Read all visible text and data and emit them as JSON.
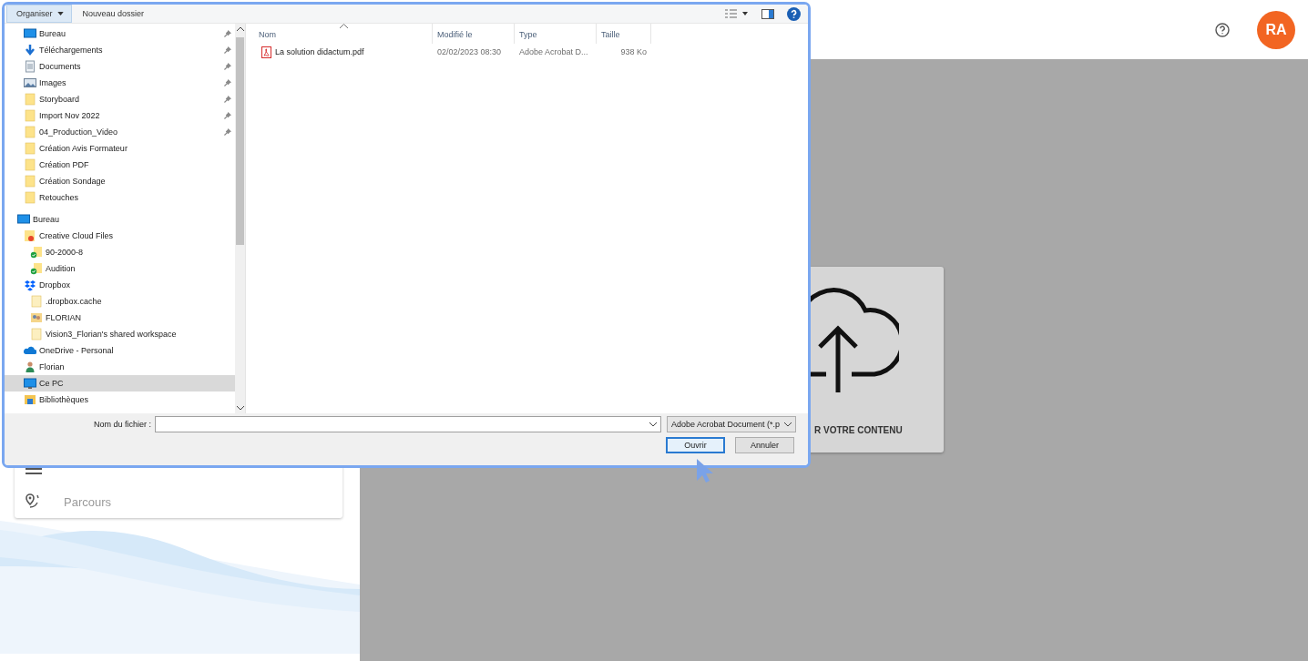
{
  "app_header": {
    "avatar_initials": "RA"
  },
  "side_menu": {
    "items": [
      {
        "kind": "settings"
      },
      {
        "label": "Parcours",
        "kind": "route"
      }
    ]
  },
  "upload_card": {
    "label": "R VOTRE CONTENU"
  },
  "dialog": {
    "toolbar": {
      "organize": "Organiser",
      "new_folder": "Nouveau dossier"
    },
    "quick_access": [
      {
        "label": "Bureau",
        "kind": "desktop",
        "pinned": true,
        "selected": false
      },
      {
        "label": "Téléchargements",
        "kind": "download",
        "pinned": true,
        "selected": false
      },
      {
        "label": "Documents",
        "kind": "documents",
        "pinned": true,
        "selected": false
      },
      {
        "label": "Images",
        "kind": "images",
        "pinned": true,
        "selected": false
      },
      {
        "label": "Storyboard",
        "kind": "folder",
        "pinned": true,
        "selected": false
      },
      {
        "label": "Import Nov 2022",
        "kind": "folder",
        "pinned": true,
        "selected": false
      },
      {
        "label": "04_Production_Video",
        "kind": "folder",
        "pinned": true,
        "selected": false
      },
      {
        "label": "Création Avis Formateur",
        "kind": "folder",
        "pinned": false,
        "selected": false
      },
      {
        "label": "Création PDF",
        "kind": "folder",
        "pinned": false,
        "selected": false
      },
      {
        "label": "Création Sondage",
        "kind": "folder",
        "pinned": false,
        "selected": false
      },
      {
        "label": "Retouches",
        "kind": "folder",
        "pinned": false,
        "selected": false
      }
    ],
    "tree": [
      {
        "label": "Bureau",
        "kind": "desktop",
        "selected": false,
        "children": [
          {
            "label": "Creative Cloud Files",
            "kind": "cloud-folder",
            "selected": false,
            "children": [
              {
                "label": "90-2000-8",
                "kind": "synced-folder",
                "selected": false
              },
              {
                "label": "Audition",
                "kind": "synced-folder",
                "selected": false
              }
            ]
          },
          {
            "label": "Dropbox",
            "kind": "dropbox",
            "selected": false,
            "children": [
              {
                "label": ".dropbox.cache",
                "kind": "pale-folder",
                "selected": false
              },
              {
                "label": "FLORIAN",
                "kind": "shared-folder",
                "selected": false
              },
              {
                "label": "Vision3_Florian's shared workspace",
                "kind": "pale-folder",
                "selected": false
              }
            ]
          },
          {
            "label": "OneDrive - Personal",
            "kind": "onedrive",
            "selected": false
          },
          {
            "label": "Florian",
            "kind": "user",
            "selected": false
          },
          {
            "label": "Ce PC",
            "kind": "pc",
            "selected": true
          },
          {
            "label": "Bibliothèques",
            "kind": "library",
            "selected": false
          }
        ]
      }
    ],
    "columns": [
      "Nom",
      "Modifié le",
      "Type",
      "Taille"
    ],
    "files": [
      {
        "name": "La solution didactum.pdf",
        "modified": "02/02/2023 08:30",
        "type": "Adobe Acrobat D...",
        "size": "938 Ko"
      }
    ],
    "filename_label": "Nom du fichier :",
    "file_type": "Adobe Acrobat Document (*.p",
    "buttons": [
      {
        "label": "Ouvrir",
        "default": true
      },
      {
        "label": "Annuler",
        "default": false
      }
    ]
  }
}
